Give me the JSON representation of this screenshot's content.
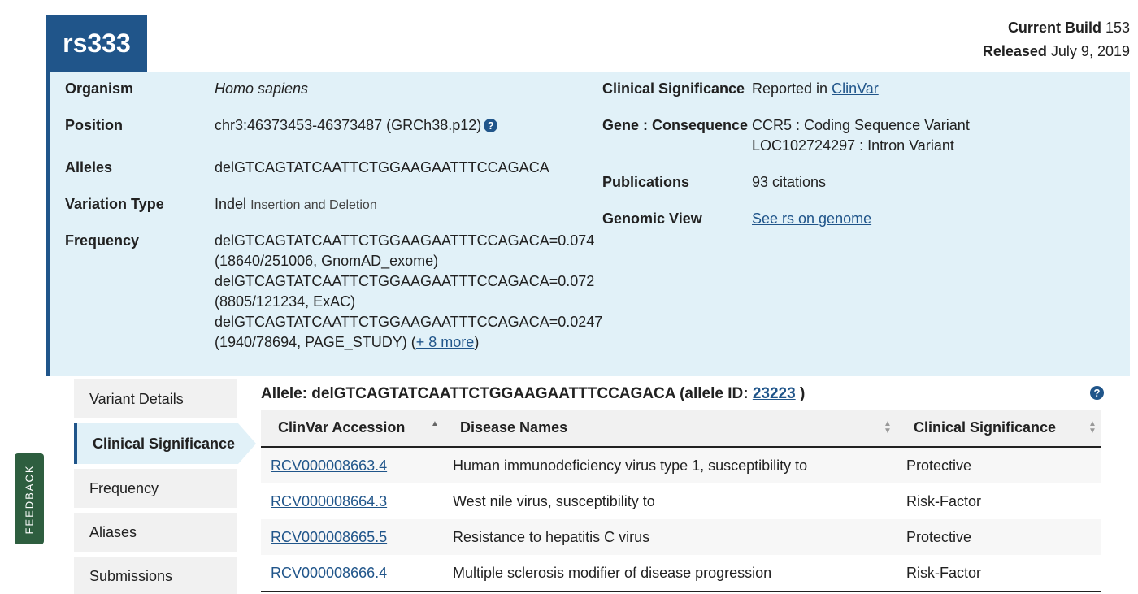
{
  "header": {
    "rsid": "rs333",
    "build_label": "Current Build",
    "build_value": "153",
    "released_label": "Released",
    "released_value": "July 9, 2019"
  },
  "summary": {
    "organism_label": "Organism",
    "organism_value": "Homo sapiens",
    "position_label": "Position",
    "position_value": "chr3:46373453-46373487 (GRCh38.p12)",
    "alleles_label": "Alleles",
    "alleles_value": "delGTCAGTATCAATTCTGGAAGAATTTCCAGACA",
    "variation_label": "Variation Type",
    "variation_value": "Indel",
    "variation_sub": "Insertion and Deletion",
    "frequency_label": "Frequency",
    "frequency_lines": [
      "delGTCAGTATCAATTCTGGAAGAATTTCCAGACA=0.074",
      "(18640/251006, GnomAD_exome)",
      "delGTCAGTATCAATTCTGGAAGAATTTCCAGACA=0.072",
      "(8805/121234, ExAC)",
      "delGTCAGTATCAATTCTGGAAGAATTTCCAGACA=0.0247",
      "(1940/78694, PAGE_STUDY) ("
    ],
    "frequency_more": "+ 8 more",
    "frequency_close": ")",
    "clinsig_label": "Clinical Significance",
    "clinsig_prefix": "Reported in",
    "clinsig_link": "ClinVar",
    "gene_label": "Gene : Consequence",
    "gene_lines": [
      "CCR5 : Coding Sequence Variant",
      "LOC102724297 : Intron Variant"
    ],
    "pub_label": "Publications",
    "pub_value": "93 citations",
    "genomic_label": "Genomic View",
    "genomic_link": "See rs on genome"
  },
  "sidenav": {
    "items": [
      "Variant Details",
      "Clinical Significance",
      "Frequency",
      "Aliases",
      "Submissions"
    ],
    "active": "Clinical Significance"
  },
  "feedback": "FEEDBACK",
  "allele_section": {
    "prefix": "Allele: delGTCAGTATCAATTCTGGAAGAATTTCCAGACA (allele ID: ",
    "allele_id": "23223",
    "suffix": " )"
  },
  "table": {
    "headers": [
      "ClinVar Accession",
      "Disease Names",
      "Clinical Significance"
    ],
    "rows": [
      {
        "accession": "RCV000008663.4",
        "disease": "Human immunodeficiency virus type 1, susceptibility to",
        "significance": "Protective"
      },
      {
        "accession": "RCV000008664.3",
        "disease": "West nile virus, susceptibility to",
        "significance": "Risk-Factor"
      },
      {
        "accession": "RCV000008665.5",
        "disease": "Resistance to hepatitis C virus",
        "significance": "Protective"
      },
      {
        "accession": "RCV000008666.4",
        "disease": "Multiple sclerosis modifier of disease progression",
        "significance": "Risk-Factor"
      }
    ]
  },
  "colors": {
    "primary": "#20558a",
    "panel": "#e1f1f8",
    "feedback": "#2e5e3f"
  },
  "icons": {
    "help": "question-circle-icon",
    "sort": "sort-arrows-icon"
  }
}
